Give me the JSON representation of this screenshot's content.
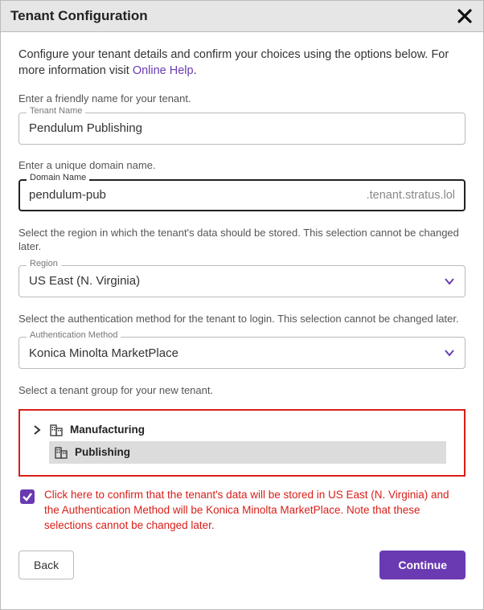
{
  "dialog": {
    "title": "Tenant Configuration"
  },
  "intro": {
    "text_before": "Configure your tenant details and confirm your choices using the options below. For more information visit ",
    "link": "Online Help",
    "text_after": "."
  },
  "tenant_name": {
    "help": "Enter a friendly name for your tenant.",
    "label": "Tenant Name",
    "value": "Pendulum Publishing"
  },
  "domain": {
    "help": "Enter a unique domain name.",
    "label": "Domain Name",
    "value": "pendulum-pub",
    "suffix": ".tenant.stratus.lol"
  },
  "region": {
    "help": "Select the region in which the tenant's data should be stored. This selection cannot be changed later.",
    "label": "Region",
    "value": "US East (N. Virginia)"
  },
  "auth": {
    "help": "Select the authentication method for the tenant to login. This selection cannot be changed later.",
    "label": "Authentication Method",
    "value": "Konica Minolta MarketPlace"
  },
  "group": {
    "help": "Select a tenant group for your new tenant.",
    "items": [
      {
        "label": "Manufacturing",
        "expandable": true,
        "selected": false
      },
      {
        "label": "Publishing",
        "expandable": false,
        "selected": true
      }
    ]
  },
  "confirm": {
    "checked": true,
    "text": "Click here to confirm that the tenant's data will be stored in US East (N. Virginia) and the Authentication Method will be Konica Minolta MarketPlace. Note that these selections cannot be changed later."
  },
  "buttons": {
    "back": "Back",
    "continue": "Continue"
  },
  "colors": {
    "accent": "#6a3ab2",
    "error": "#d91e18"
  }
}
